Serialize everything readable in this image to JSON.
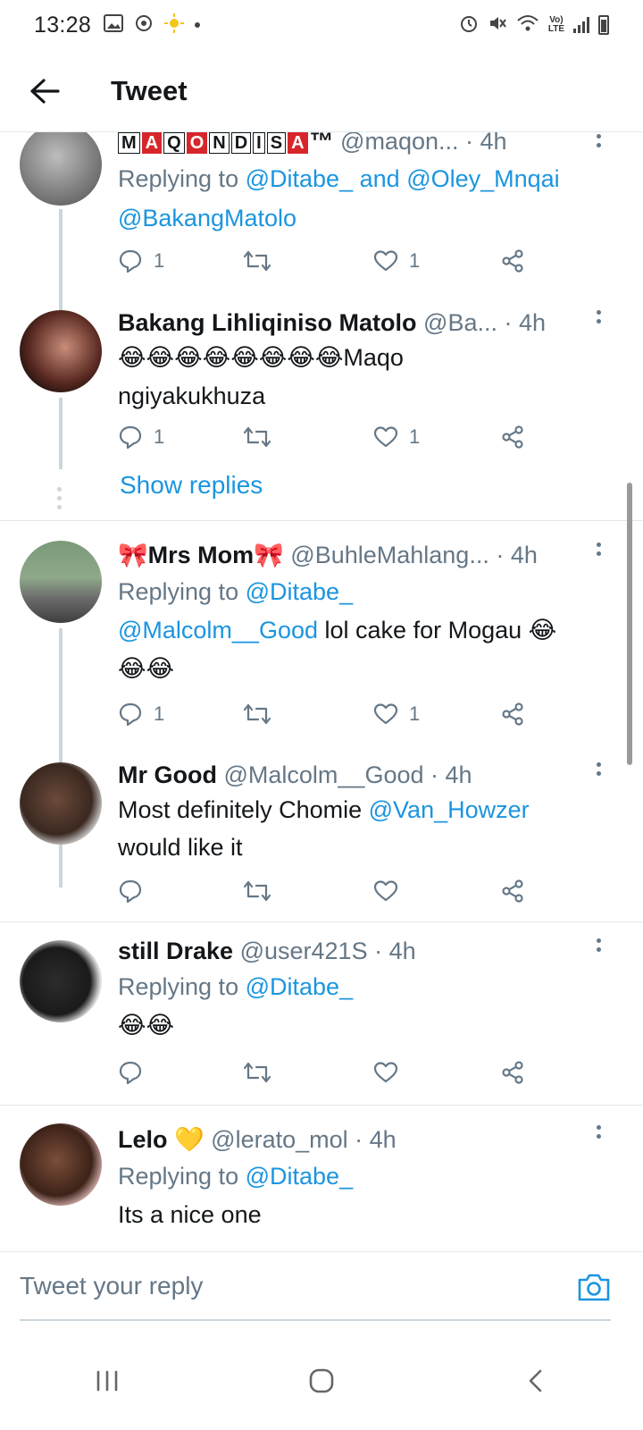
{
  "status_bar": {
    "time": "13:28",
    "left_icons": [
      "gallery-icon",
      "sync-icon",
      "sun-icon",
      "dot-icon"
    ],
    "right_icons": [
      "alarm-icon",
      "mute-icon",
      "wifi-icon",
      "lte-icon",
      "signal-icon",
      "battery-icon"
    ],
    "lte_line1": "Vo)",
    "lte_line2": "LTE"
  },
  "header": {
    "title": "Tweet",
    "back_icon": "arrow-left-icon"
  },
  "colors": {
    "link": "#1b95e0",
    "secondary_text": "#657786",
    "divider": "#e1e8ed",
    "thread_line": "#ccd6dd"
  },
  "tweets": [
    {
      "brand_letters": [
        "M",
        "A",
        "Q",
        "O",
        "N",
        "D",
        "I",
        "S",
        "A"
      ],
      "brand_tm": "™",
      "handle": "@maqon...",
      "time": "· 4h",
      "replying_prefix": "Replying to",
      "replying_1": "@Ditabe_",
      "replying_and": "and",
      "replying_2": "@Oley_Mnqai",
      "replying_3": "@BakangMatolo",
      "reply_count": "1",
      "like_count": "1"
    },
    {
      "name": "Bakang Lihliqiniso Matolo",
      "handle": "@Ba...",
      "time": "· 4h",
      "emojis": "😂😂😂😂😂😂😂😂",
      "text_1": "Maqo",
      "text_2": "ngiyakukhuza",
      "reply_count": "1",
      "like_count": "1",
      "show_replies": "Show replies"
    },
    {
      "name_emoji": "🎀",
      "name": "Mrs Mom",
      "handle": "@BuhleMahlang...",
      "time": "· 4h",
      "replying_prefix": "Replying to",
      "replying_1": "@Ditabe_",
      "mention": "@Malcolm__Good",
      "text": "lol cake for Mogau",
      "emojis_1": "😂",
      "emojis_2": "😂😂",
      "reply_count": "1",
      "like_count": "1"
    },
    {
      "name": "Mr Good",
      "handle": "@Malcolm__Good",
      "time": "· 4h",
      "text_1": "Most definitely Chomie",
      "mention": "@Van_Howzer",
      "text_2": "would like it"
    },
    {
      "name": "still Drake",
      "handle": "@user421S",
      "time": "· 4h",
      "replying_prefix": "Replying to",
      "replying_1": "@Ditabe_",
      "emojis": "😂😂"
    },
    {
      "name": "Lelo",
      "name_emoji": "💛",
      "handle": "@lerato_mol",
      "time": "· 4h",
      "replying_prefix": "Replying to",
      "replying_1": "@Ditabe_",
      "text": "Its a nice one"
    }
  ],
  "reply_bar": {
    "placeholder": "Tweet your reply",
    "camera_icon": "camera-icon"
  },
  "nav_bar": {
    "icons": [
      "recent-apps-icon",
      "home-icon",
      "back-icon"
    ]
  }
}
